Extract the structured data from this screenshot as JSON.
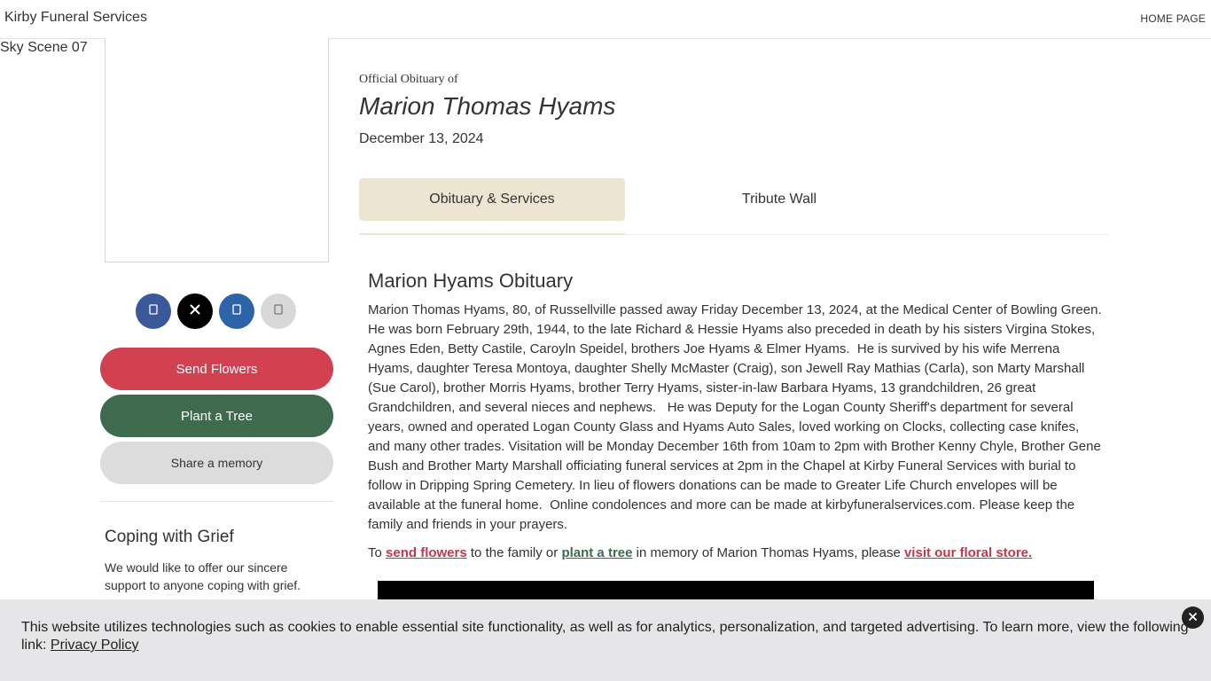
{
  "header": {
    "brand": "Kirby Funeral Services",
    "home_link": "HOME PAGE"
  },
  "sidebar": {
    "sky_label": "Sky Scene 07",
    "social_icons": [
      "facebook-icon",
      "x-icon",
      "linkedin-icon",
      "email-icon"
    ],
    "buttons": {
      "send_flowers": "Send Flowers",
      "plant_tree": "Plant a Tree",
      "share_memory": "Share a memory"
    },
    "coping": {
      "title": "Coping with Grief",
      "text": "We would like to offer our sincere support to anyone coping with grief."
    }
  },
  "obituary": {
    "official_label": "Official Obituary of",
    "name": "Marion Thomas Hyams",
    "date": "December 13, 2024",
    "tabs": [
      {
        "label": "Obituary & Services",
        "active": true
      },
      {
        "label": "Tribute Wall",
        "active": false
      }
    ],
    "heading": "Marion Hyams Obituary",
    "body": "Marion Thomas Hyams, 80, of Russellville passed away Friday December 13, 2024, at the Medical Center of Bowling Green.   He was born February 29th, 1944, to the late Richard & Hessie Hyams also preceded in death by his sisters Virgina Stokes, Agnes Eden, Betty Castile, Caroyln Speidel, brothers Joe Hyams & Elmer Hyams.  He is survived by his wife Merrena Hyams, daughter Teresa Montoya, daughter Shelly McMaster (Craig), son Jewell Ray Mathias (Carla), son Marty Marshall (Sue Carol), brother Morris Hyams, brother Terry Hyams, sister-in-law Barbara Hyams, 13 grandchildren, 26 great Grandchildren, and several nieces and nephews.   He was Deputy for the Logan County Sheriff's department for several years, owned and operated Logan County Glass and Hyams Auto Sales, loved working on Clocks, collecting case knifes, and many other trades. Visitation will be Monday December 16th from 10am to 2pm with Brother Kenny Chyle, Brother Gene Bush and Brother Marty Marshall officiating funeral services at 2pm in the Chapel at Kirby Funeral Services with burial to follow in Dripping Spring Cemetery. In lieu of flowers donations can be made to Greater Life Church envelopes will be available at the funeral home.  Online condolences and more can be made at kirbyfuneralservices.com. Please keep the family and friends in your prayers.",
    "cta": {
      "prefix": "To ",
      "flowers_link": "send flowers",
      "middle1": " to the family or ",
      "tree_link": "plant a tree",
      "middle2": " in memory of Marion Thomas Hyams, please ",
      "store_link": "visit our floral store."
    }
  },
  "cookie": {
    "text": "This website utilizes technologies such as cookies to enable essential site functionality, as well as for analytics, personalization, and targeted advertising. To learn more, view the following link: ",
    "link": "Privacy Policy"
  },
  "colors": {
    "flowers_red": "#d2414f",
    "tree_green": "#3e6a4e",
    "tab_active_bg": "#ede5d2",
    "cookie_bg": "#e6e6e8"
  }
}
